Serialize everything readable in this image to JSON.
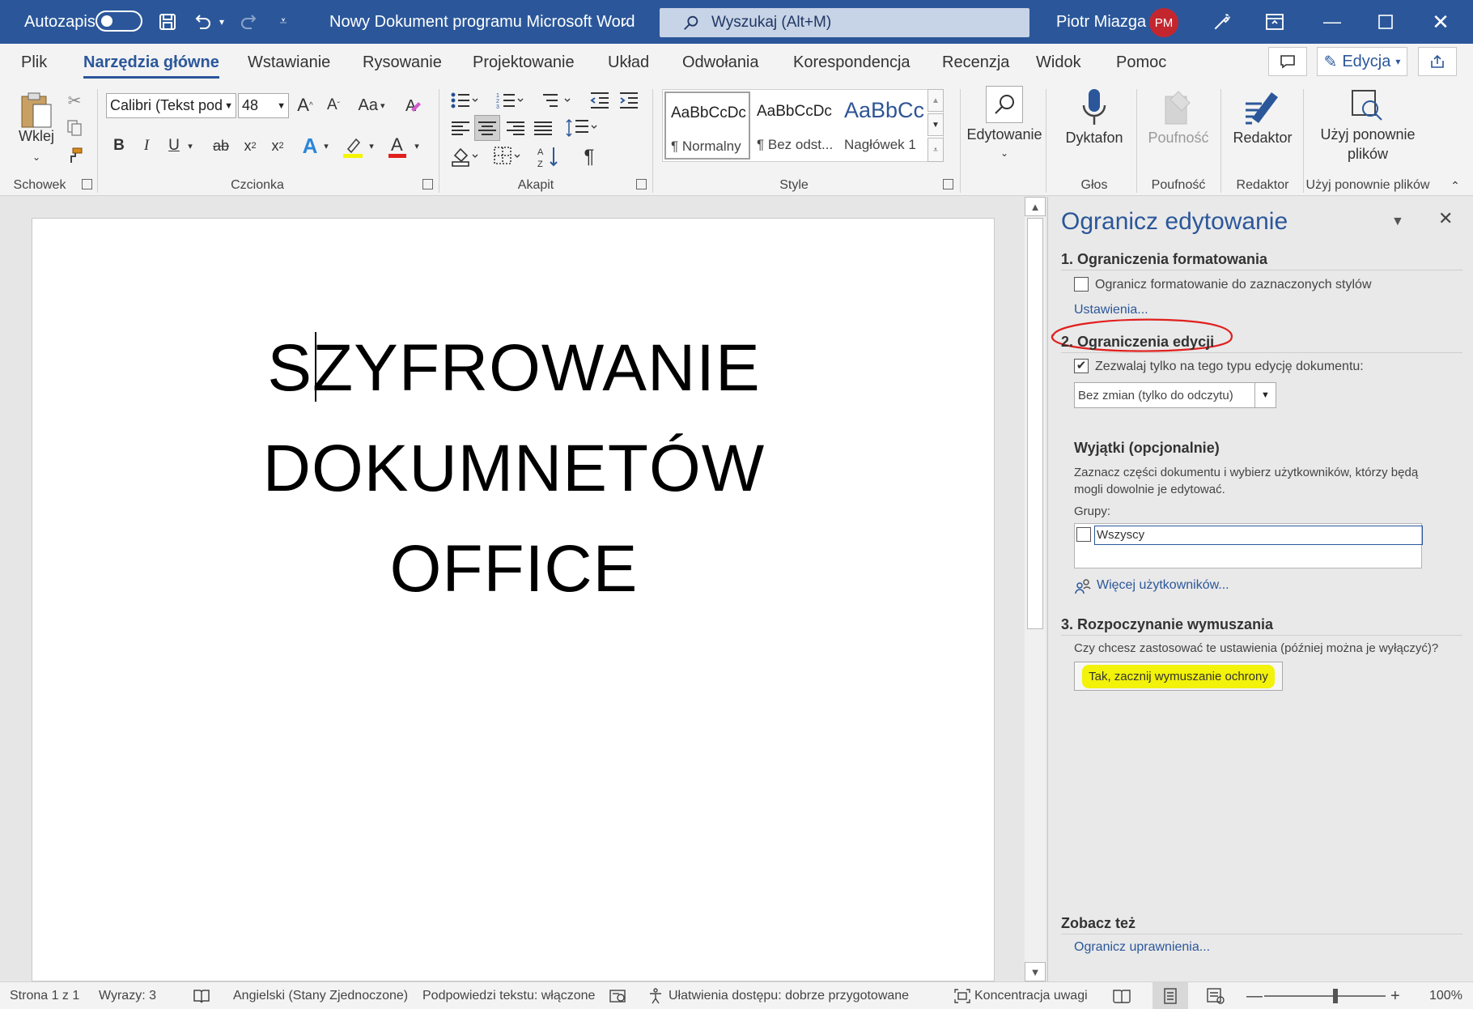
{
  "titlebar": {
    "autosave_label": "Autozapis",
    "doc_title": "Nowy Dokument programu Microsoft Word",
    "search_placeholder": "Wyszukaj (Alt+M)",
    "user_name": "Piotr Miazga",
    "user_initials": "PM",
    "accent": "#2b579a"
  },
  "tabs": [
    "Plik",
    "Narzędzia główne",
    "Wstawianie",
    "Rysowanie",
    "Projektowanie",
    "Układ",
    "Odwołania",
    "Korespondencja",
    "Recenzja",
    "Widok",
    "Pomoc"
  ],
  "tab_right": {
    "editing_label": "Edycja"
  },
  "ribbon": {
    "paste_label": "Wklej",
    "font_name": "Calibri (Tekst pod",
    "font_size": "48",
    "change_case_label": "Aa",
    "styles": [
      {
        "sample": "AaBbCcDc",
        "name": "¶ Normalny"
      },
      {
        "sample": "AaBbCcDc",
        "name": "¶ Bez odst..."
      },
      {
        "sample": "AaBbCc",
        "name": "Nagłówek 1"
      }
    ],
    "editing_label": "Edytowanie",
    "dictate_label": "Dyktafon",
    "sensitivity_label": "Poufność",
    "editor_label": "Redaktor",
    "reuse_label_line1": "Użyj ponownie",
    "reuse_label_line2": "plików",
    "groups": {
      "clipboard": "Schowek",
      "font": "Czcionka",
      "paragraph": "Akapit",
      "styles": "Style",
      "voice": "Głos",
      "sensitivity": "Poufność",
      "editor": "Redaktor",
      "reuse": "Użyj ponownie plików"
    }
  },
  "document": {
    "lines": [
      "SZYFROWANIE",
      "DOKUMNETÓW",
      "OFFICE"
    ]
  },
  "panel": {
    "title": "Ogranicz edytowanie",
    "sec1_title": "1. Ograniczenia formatowania",
    "sec1_checkbox": "Ogranicz formatowanie do zaznaczonych stylów",
    "sec1_checked": false,
    "sec1_link": "Ustawienia...",
    "sec2_title": "2. Ograniczenia edycji",
    "sec2_checkbox": "Zezwalaj tylko na tego typu edycję dokumentu:",
    "sec2_checked": true,
    "sec2_select": "Bez zmian (tylko do odczytu)",
    "exceptions_title": "Wyjątki (opcjonalnie)",
    "exceptions_desc_1": "Zaznacz części dokumentu i wybierz użytkowników, którzy będą",
    "exceptions_desc_2": "mogli dowolnie je edytować.",
    "groups_label": "Grupy:",
    "group_everyone": "Wszyscy",
    "more_users_link": "Więcej użytkowników...",
    "sec3_title": "3. Rozpoczynanie wymuszania",
    "sec3_question": "Czy chcesz zastosować te ustawienia (później można je wyłączyć)?",
    "sec3_button": "Tak, zacznij wymuszanie ochrony",
    "see_also_title": "Zobacz też",
    "see_also_link": "Ogranicz uprawnienia...",
    "highlight_color": "#f2f20a",
    "annotation_color": "#e0201e"
  },
  "status": {
    "page": "Strona 1 z 1",
    "words": "Wyrazy: 3",
    "language": "Angielski (Stany Zjednoczone)",
    "text_predictions": "Podpowiedzi tekstu: włączone",
    "accessibility": "Ułatwienia dostępu: dobrze przygotowane",
    "focus": "Koncentracja uwagi",
    "zoom": "100%",
    "zoom_level": 100
  }
}
